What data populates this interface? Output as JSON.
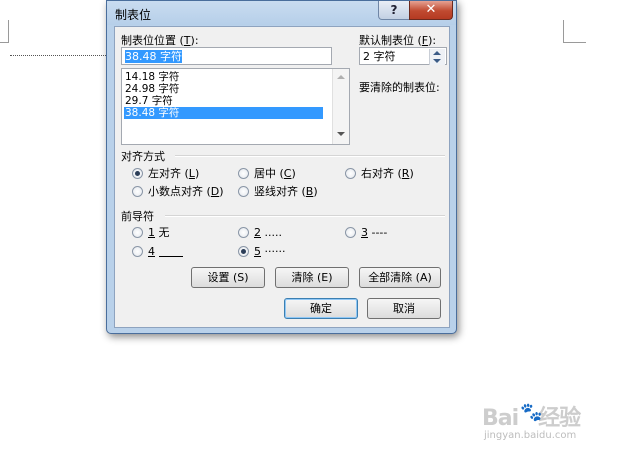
{
  "dialog": {
    "title": "制表位",
    "help_glyph": "?",
    "close_glyph": "✕",
    "tab_stop_position": {
      "label_main": "制表位位置 (",
      "label_key": "T",
      "label_end": "):",
      "value": "38.48 字符"
    },
    "tab_list": [
      "14.18 字符",
      "24.98 字符",
      "29.7 字符",
      "38.48 字符"
    ],
    "default_tab": {
      "label_main": "默认制表位 (",
      "label_key": "F",
      "label_end": "):",
      "value": "2 字符"
    },
    "to_clear_label": "要清除的制表位:",
    "alignment": {
      "heading": "对齐方式",
      "options": [
        {
          "text": "左对齐 (",
          "key": "L",
          "end": ")",
          "checked": true
        },
        {
          "text": "居中 (",
          "key": "C",
          "end": ")",
          "checked": false
        },
        {
          "text": "右对齐 (",
          "key": "R",
          "end": ")",
          "checked": false
        },
        {
          "text": "小数点对齐 (",
          "key": "D",
          "end": ")",
          "checked": false
        },
        {
          "text": "竖线对齐 (",
          "key": "B",
          "end": ")",
          "checked": false
        }
      ]
    },
    "leader": {
      "heading": "前导符",
      "options": [
        {
          "key": "1",
          "text": " 无",
          "checked": false
        },
        {
          "key": "2",
          "text": " .....",
          "checked": false
        },
        {
          "key": "3",
          "text": " ----",
          "checked": false
        },
        {
          "key": "4",
          "text": "",
          "checked": false
        },
        {
          "key": "5",
          "text": " ······",
          "checked": true
        }
      ]
    },
    "buttons": {
      "set": "设置 (S)",
      "clear": "清除 (E)",
      "clear_all": "全部清除 (A)",
      "ok": "确定",
      "cancel": "取消"
    }
  },
  "watermark": {
    "brand": "Bai",
    "brand_tail": "经验",
    "url": "jingyan.baidu.com"
  }
}
